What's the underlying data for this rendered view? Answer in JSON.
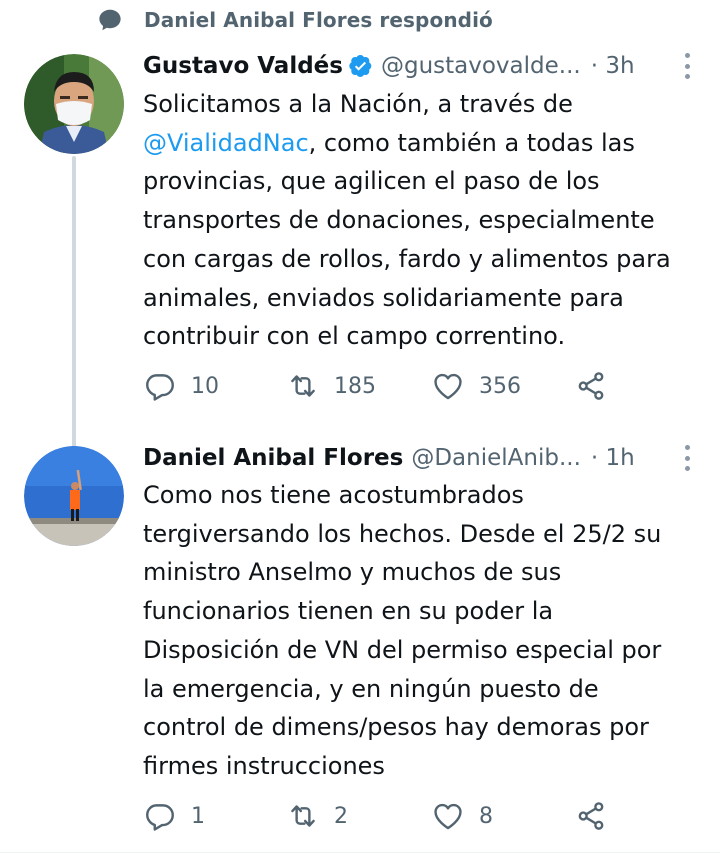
{
  "context": {
    "text": "Daniel Anibal Flores respondió",
    "icon": "speech-bubble-icon"
  },
  "tweets": [
    {
      "name": "Gustavo Valdés",
      "verified": true,
      "handle": "@gustavovalde...",
      "time": "· 3h",
      "text_before": "Solicitamos a la Nación, a través de\n",
      "mention": "@VialidadNac",
      "text_after": ", como también a todas las\nprovincias, que agilicen el paso de los\ntransportes de donaciones, especialmente\ncon cargas de rollos, fardo y alimentos para\nanimales, enviados solidariamente para\ncontribuir con el campo correntino.",
      "replies": "10",
      "retweets": "185",
      "likes": "356"
    },
    {
      "name": "Daniel Anibal Flores",
      "verified": false,
      "handle": "@DanielAnib...",
      "time": "· 1h",
      "text": "Como nos tiene acostumbrados\ntergiversando los hechos. Desde el 25/2 su\nministro Anselmo y muchos de sus\nfuncionarios tienen en su poder la\nDisposición de VN del permiso especial por\nla emergencia, y en ningún puesto de\ncontrol de dimens/pesos hay demoras por\nfirmes instrucciones",
      "replies": "1",
      "retweets": "2",
      "likes": "8"
    }
  ],
  "colors": {
    "accent": "#1d9bf0",
    "secondary_text": "#536471",
    "primary_text": "#0f1419",
    "thread_line": "#cfd9de"
  }
}
